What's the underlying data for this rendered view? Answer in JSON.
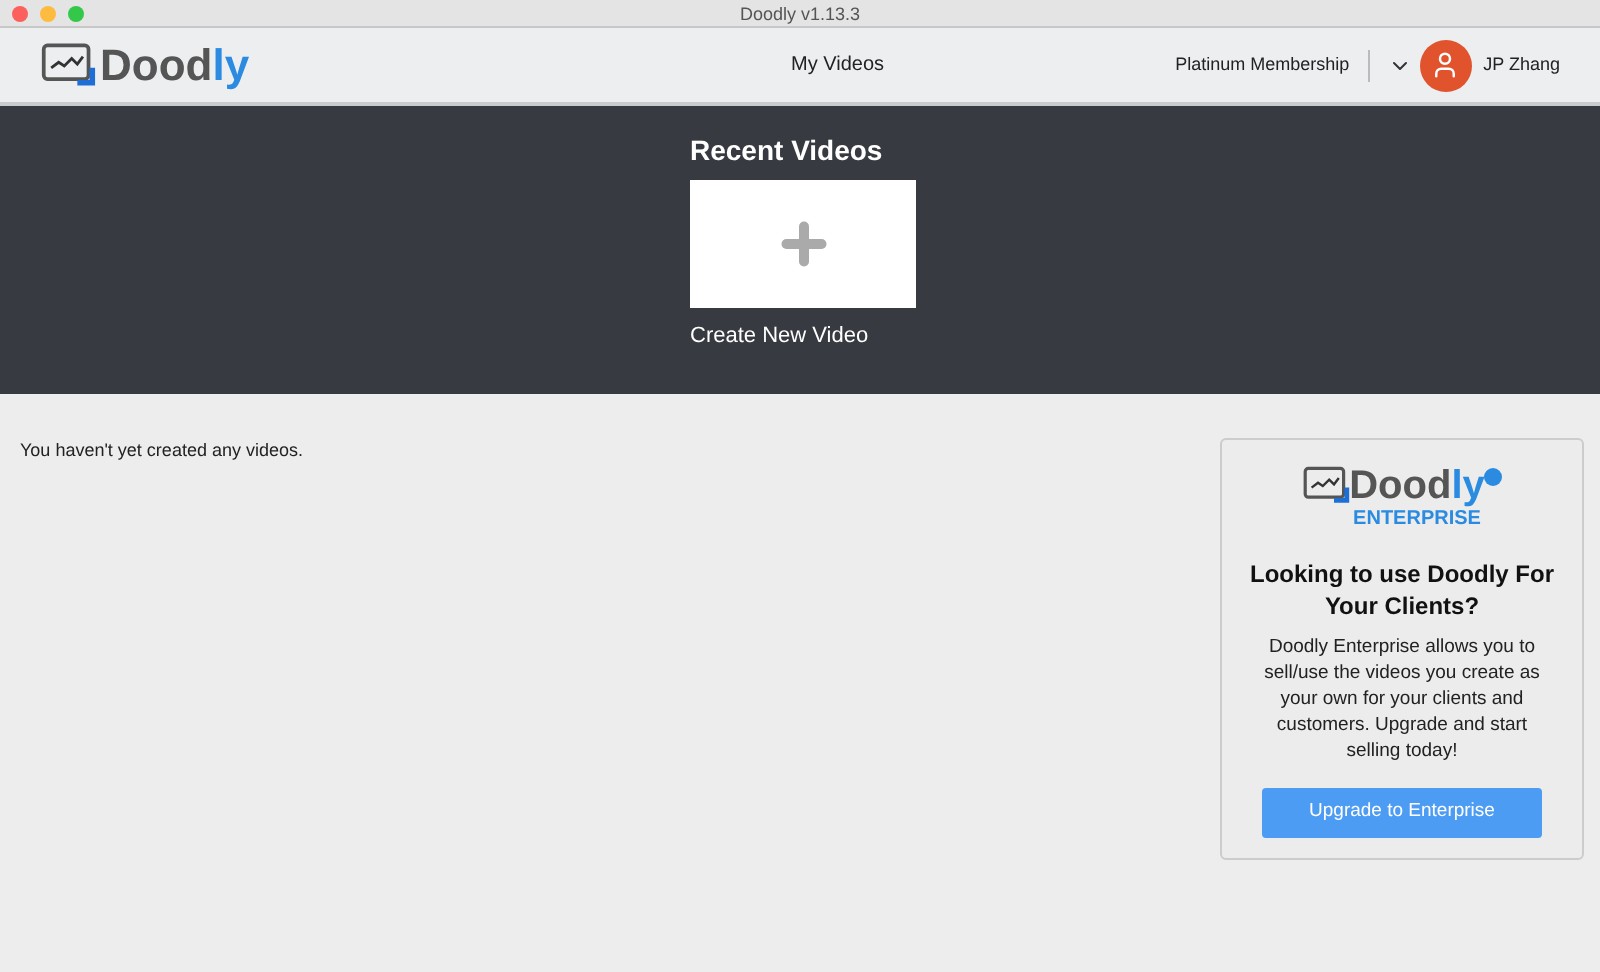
{
  "window": {
    "title": "Doodly v1.13.3"
  },
  "header": {
    "logo": {
      "text_main": "Dood",
      "text_accent": "ly"
    },
    "nav": "My Videos",
    "membership": "Platinum Membership",
    "user": "JP Zhang"
  },
  "recent": {
    "title": "Recent Videos",
    "create_label": "Create New Video"
  },
  "empty_message": "You haven't yet created any videos.",
  "promo": {
    "logo": {
      "text_main": "Dood",
      "text_accent": "ly",
      "subtitle": "ENTERPRISE"
    },
    "heading": "Looking to use Doodly For Your Clients?",
    "body": "Doodly Enterprise allows you to sell/use the videos you create as your own for your clients and customers. Upgrade and start selling today!",
    "button": "Upgrade to Enterprise"
  }
}
